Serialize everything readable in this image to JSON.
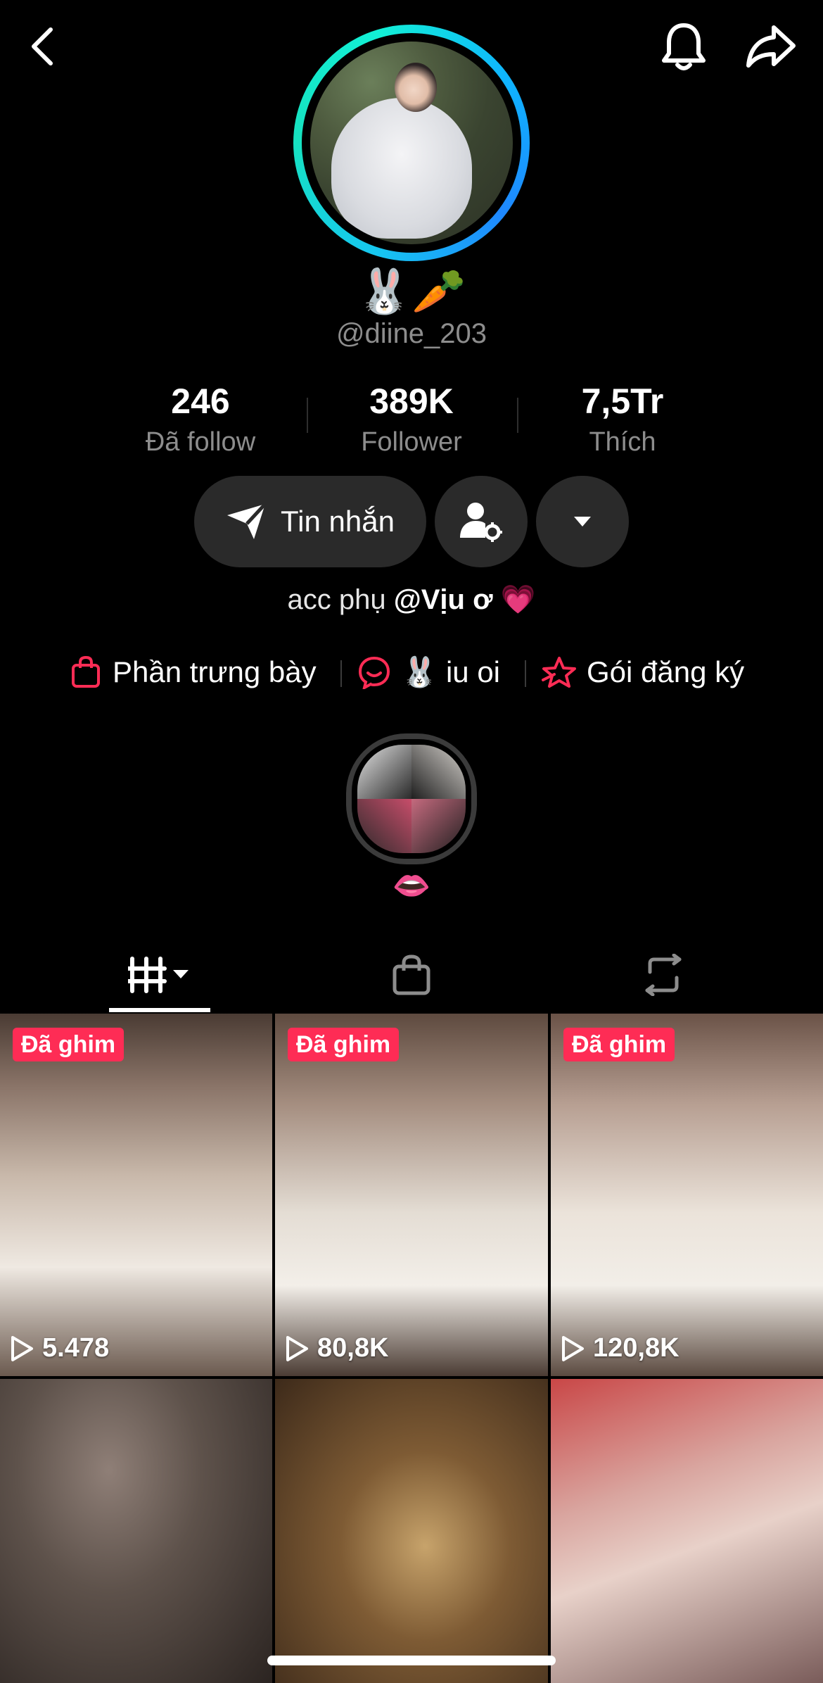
{
  "profile": {
    "emoji_name": "🐰🥕",
    "username": "@diine_203",
    "bio_prefix": "acc phụ ",
    "bio_mention": "@Vịu ơ",
    "bio_emoji": "💗"
  },
  "stats": [
    {
      "value": "246",
      "label": "Đã follow"
    },
    {
      "value": "389K",
      "label": "Follower"
    },
    {
      "value": "7,5Tr",
      "label": "Thích"
    }
  ],
  "actions": {
    "message_label": "Tin nhắn"
  },
  "links": [
    {
      "label": "Phần trưng bày",
      "icon": "shopping-bag-icon"
    },
    {
      "label": "🐰 iu oi",
      "icon": "chat-group-icon"
    },
    {
      "label": "Gói đăng ký",
      "icon": "subscription-star-icon"
    }
  ],
  "highlight": {
    "label": "👄"
  },
  "tabs": [
    {
      "name": "videos-grid",
      "icon": "grid-icon",
      "active": true
    },
    {
      "name": "shop",
      "icon": "bag-icon",
      "active": false
    },
    {
      "name": "reposts",
      "icon": "repost-icon",
      "active": false
    }
  ],
  "videos": [
    {
      "pinned": true,
      "pin_label": "Đã ghim",
      "views": "5.478"
    },
    {
      "pinned": true,
      "pin_label": "Đã ghim",
      "views": "80,8K"
    },
    {
      "pinned": true,
      "pin_label": "Đã ghim",
      "views": "120,8K"
    },
    {
      "pinned": false,
      "views": ""
    },
    {
      "pinned": false,
      "views": ""
    },
    {
      "pinned": false,
      "views": ""
    }
  ],
  "colors": {
    "accent": "#fe2c55",
    "ring_start": "#16c8f0",
    "ring_end": "#12f0d6",
    "pill_bg": "#2a2a2a",
    "muted_text": "#8d8d8d"
  }
}
